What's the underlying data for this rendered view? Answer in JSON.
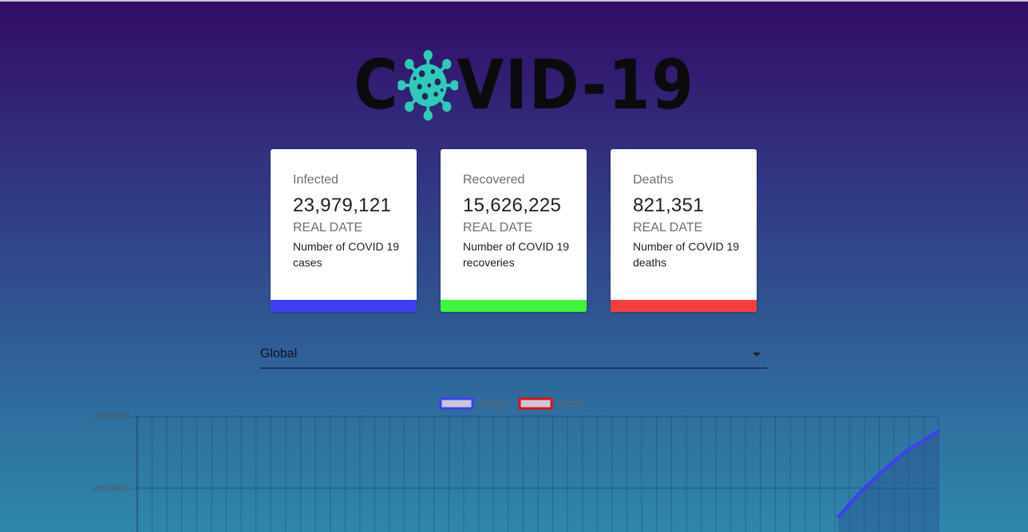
{
  "header": {
    "logo_text_before": "C",
    "logo_text_after": "VID-19"
  },
  "cards": [
    {
      "title": "Infected",
      "value": "23,979,121",
      "subtitle": "REAL DATE",
      "description": "Number of COVID 19 cases",
      "color": "#3f3ff5"
    },
    {
      "title": "Recovered",
      "value": "15,626,225",
      "subtitle": "REAL DATE",
      "description": "Number of COVID 19 recoveries",
      "color": "#3ff53f"
    },
    {
      "title": "Deaths",
      "value": "821,351",
      "subtitle": "REAL DATE",
      "description": "Number of COVID 19 deaths",
      "color": "#f53f3f"
    }
  ],
  "country_select": {
    "selected": "Global"
  },
  "chart_data": {
    "type": "line",
    "legend_position": "top-center",
    "series": [
      {
        "name": "Infected",
        "color": "#3f3ff5"
      },
      {
        "name": "Deaths",
        "color": "#e01010"
      }
    ],
    "y_ticks": [
      "25000000",
      "20000000"
    ],
    "infected_tail": [
      [
        0.875,
        18000000
      ],
      [
        0.9,
        19600000
      ],
      [
        0.93,
        21200000
      ],
      [
        0.96,
        22600000
      ],
      [
        1.0,
        23979121
      ]
    ],
    "ylim": [
      0,
      25000000
    ]
  }
}
